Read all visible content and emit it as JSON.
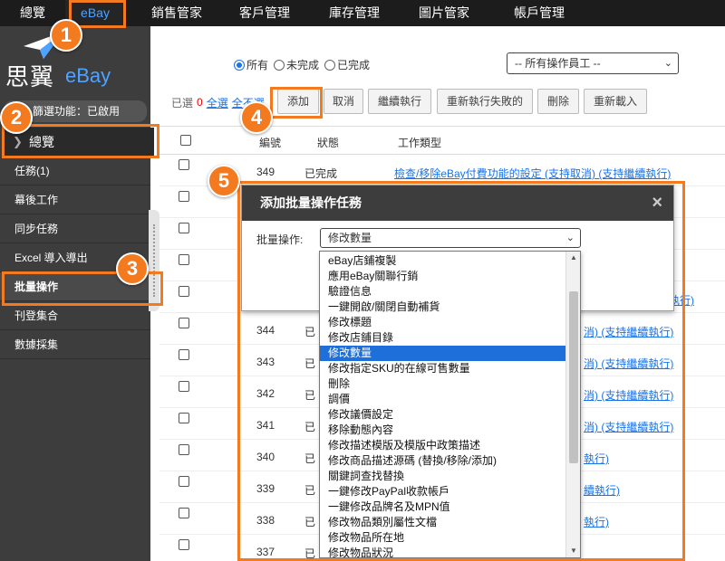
{
  "topnav": {
    "items": [
      {
        "label": "總覽"
      },
      {
        "label": "eBay"
      },
      {
        "label": "銷售管家"
      },
      {
        "label": "客戶管理"
      },
      {
        "label": "庫存管理"
      },
      {
        "label": "圖片管家"
      },
      {
        "label": "帳戶管理"
      }
    ]
  },
  "sidebar": {
    "logo_cn": "思翼",
    "logo_ebay": "eBay",
    "filter_status": "篩選功能：已啟用",
    "overview": "總覽",
    "menu": [
      {
        "label": "任務(1)"
      },
      {
        "label": "幕後工作"
      },
      {
        "label": "同步任務"
      },
      {
        "label": "Excel 導入導出"
      },
      {
        "label": "批量操作"
      },
      {
        "label": "刊登集合"
      },
      {
        "label": "數據採集"
      }
    ]
  },
  "filters": {
    "status_options": [
      {
        "label": "所有",
        "checked": true
      },
      {
        "label": "未完成",
        "checked": false
      },
      {
        "label": "已完成",
        "checked": false
      }
    ],
    "staff_select": "-- 所有操作員工 --"
  },
  "toolbar": {
    "selected_prefix": "已選",
    "selected_count": "0",
    "select_all": "全選",
    "unselect_all": "全不選",
    "buttons": {
      "add": "添加",
      "cancel": "取消",
      "continue": "繼續執行",
      "retry_failed": "重新執行失敗的",
      "delete": "刪除",
      "reload": "重新載入"
    }
  },
  "table": {
    "headers": {
      "number": "編號",
      "status": "狀態",
      "job_type": "工作類型"
    },
    "rows": [
      {
        "number": "349",
        "status": "已完成",
        "job": "檢查/移除eBay付費功能的設定 (支持取消) (支持繼續執行)"
      },
      {
        "number": "",
        "status": "",
        "job": ""
      },
      {
        "number": "",
        "status": "",
        "job": ""
      },
      {
        "number": "",
        "status": "",
        "job": ""
      },
      {
        "number": "",
        "status": "",
        "job": "繼續執行)"
      },
      {
        "number": "344",
        "status": "已",
        "job": "消) (支持繼續執行)"
      },
      {
        "number": "343",
        "status": "已",
        "job": "消) (支持繼續執行)"
      },
      {
        "number": "342",
        "status": "已",
        "job": "消) (支持繼續執行)"
      },
      {
        "number": "341",
        "status": "已",
        "job": "消) (支持繼續執行)"
      },
      {
        "number": "340",
        "status": "已",
        "job": "執行)"
      },
      {
        "number": "339",
        "status": "已",
        "job": "續執行)"
      },
      {
        "number": "338",
        "status": "已",
        "job": "執行)"
      },
      {
        "number": "337",
        "status": "已",
        "job": ""
      }
    ]
  },
  "modal": {
    "title": "添加批量操作任務",
    "close": "×",
    "label": "批量操作:",
    "selected": "修改數量",
    "options": [
      "eBay店鋪複製",
      "應用eBay關聯行銷",
      "驗證信息",
      "一鍵開啟/關閉自動補貨",
      "修改標題",
      "修改店鋪目錄",
      "修改數量",
      "修改指定SKU的在線可售數量",
      "刪除",
      "調價",
      "修改議價設定",
      "移除動態內容",
      "修改描述模版及模版中政策描述",
      "修改商品描述源碼 (替換/移除/添加)",
      "關鍵詞查找替換",
      "一鍵修改PayPal收款帳戶",
      "一鍵修改品牌名及MPN值",
      "修改物品類別屬性文檔",
      "修改物品所在地",
      "修改物品狀況"
    ],
    "selected_index": 6
  },
  "annotations": {
    "badges": [
      "1",
      "2",
      "3",
      "4",
      "5"
    ],
    "color": "#f47a20"
  }
}
